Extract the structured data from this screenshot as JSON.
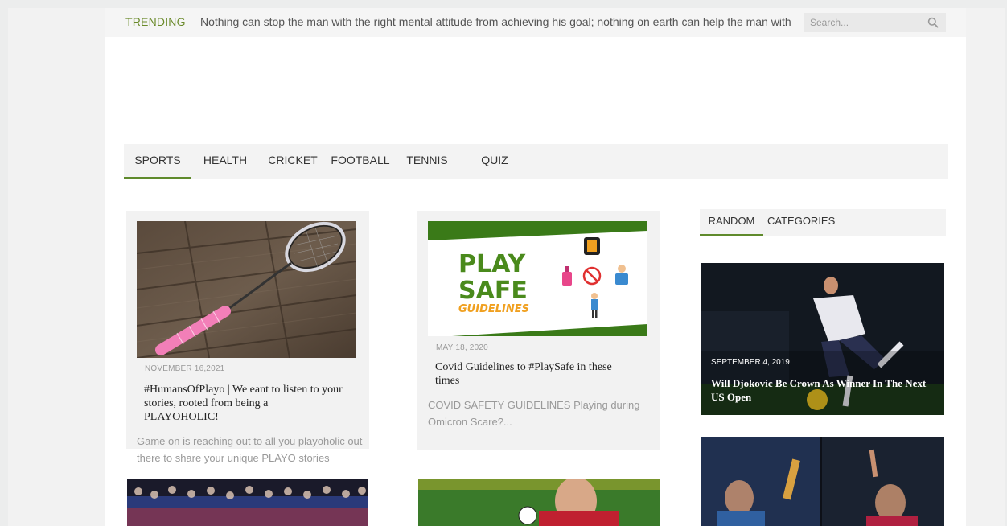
{
  "topbar": {
    "trending_label": "TRENDING",
    "trending_text": "Nothing can stop the man with the right mental attitude from achieving his goal; nothing on earth can help the man with",
    "search_placeholder": "Search..."
  },
  "nav": {
    "items": [
      {
        "label": "SPORTS",
        "active": true
      },
      {
        "label": "HEALTH",
        "active": false
      },
      {
        "label": "CRICKET",
        "active": false
      },
      {
        "label": "FOOTBALL",
        "active": false
      },
      {
        "label": "TENNIS",
        "active": false
      },
      {
        "label": "QUIZ",
        "active": false
      }
    ]
  },
  "posts": [
    {
      "date": "NOVEMBER 16,2021",
      "title": "#HumansOfPlayo | We eant to listen to your stories, rooted from being a PLAYOHOLIC!",
      "excerpt": "Game on is reaching out to all you playoholic out there to share your unique PLAYO stories"
    },
    {
      "date": "MAY 18, 2020",
      "title": "Covid Guidelines to #PlaySafe in these times",
      "excerpt": "COVID SAFETY GUIDELINES Playing during Omicron Scare?...",
      "image_text": {
        "line1": "PLAY",
        "line2": "SAFE",
        "line3": "GUIDELINES"
      }
    }
  ],
  "sidebar": {
    "tabs": [
      {
        "label": "RANDOM",
        "active": true
      },
      {
        "label": "CATEGORIES",
        "active": false
      }
    ],
    "items": [
      {
        "date": "SEPTEMBER 4, 2019",
        "title": "Will Djokovic Be Crown As Winner In The Next US Open"
      }
    ]
  },
  "colors": {
    "accent_green": "#5f8a2c",
    "trending_green": "#6a8a2a"
  }
}
